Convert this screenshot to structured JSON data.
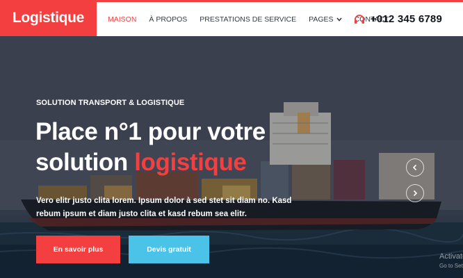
{
  "brand": {
    "name": "Logistique"
  },
  "nav": {
    "items": [
      {
        "label": "MAISON",
        "active": true
      },
      {
        "label": "À PROPOS",
        "active": false
      },
      {
        "label": "PRESTATIONS DE SERVICE",
        "active": false
      },
      {
        "label": "PAGES",
        "active": false,
        "dropdown": true
      },
      {
        "label": "CONTACT",
        "active": false
      }
    ],
    "phone": "+012 345 6789"
  },
  "hero": {
    "subtitle": "SOLUTION TRANSPORT & LOGISTIQUE",
    "title_line1": "Place n°1 pour votre",
    "title_line2_plain": "solution ",
    "title_line2_accent": "logistique",
    "description": "Vero elitr justo clita lorem. Ipsum dolor à sed stet sit diam no. Kasd rebum ipsum et diam justo clita et kasd rebum sea elitr.",
    "btn_primary": "En savoir plus",
    "btn_secondary": "Devis gratuit"
  },
  "carousel": {
    "prev_icon": "chevron-left-icon",
    "next_icon": "chevron-right-icon"
  },
  "watermark": {
    "line1": "Activate Windows",
    "line2": "Go to Settings to activate Windows."
  },
  "colors": {
    "accent": "#f33f3f",
    "secondary": "#4bc2e8",
    "nav_text": "#333a45"
  }
}
